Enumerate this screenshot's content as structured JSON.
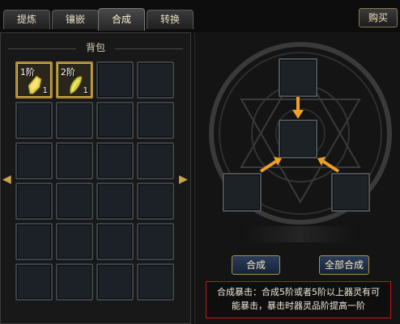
{
  "tabs": [
    {
      "label": "提炼",
      "active": false
    },
    {
      "label": "镶嵌",
      "active": false
    },
    {
      "label": "合成",
      "active": true
    },
    {
      "label": "转换",
      "active": false
    }
  ],
  "buy_button": "购买",
  "bag": {
    "title": "背包",
    "items": [
      {
        "tier": "1阶",
        "count": "1",
        "icon": "gem-icon",
        "color": "#e8d24a"
      },
      {
        "tier": "2阶",
        "count": "1",
        "icon": "gem-icon",
        "color": "#d8d23a"
      }
    ]
  },
  "buttons": {
    "compose": "合成",
    "compose_all": "全部合成"
  },
  "info": {
    "line1": "合成暴击：合成5阶或者5阶以上器灵有可",
    "line2": "能暴击，暴击时器灵品阶提高一阶"
  },
  "colors": {
    "accent_gold": "#d9a53a",
    "arrow_orange": "#f0a020",
    "warning_red": "#c01818"
  }
}
